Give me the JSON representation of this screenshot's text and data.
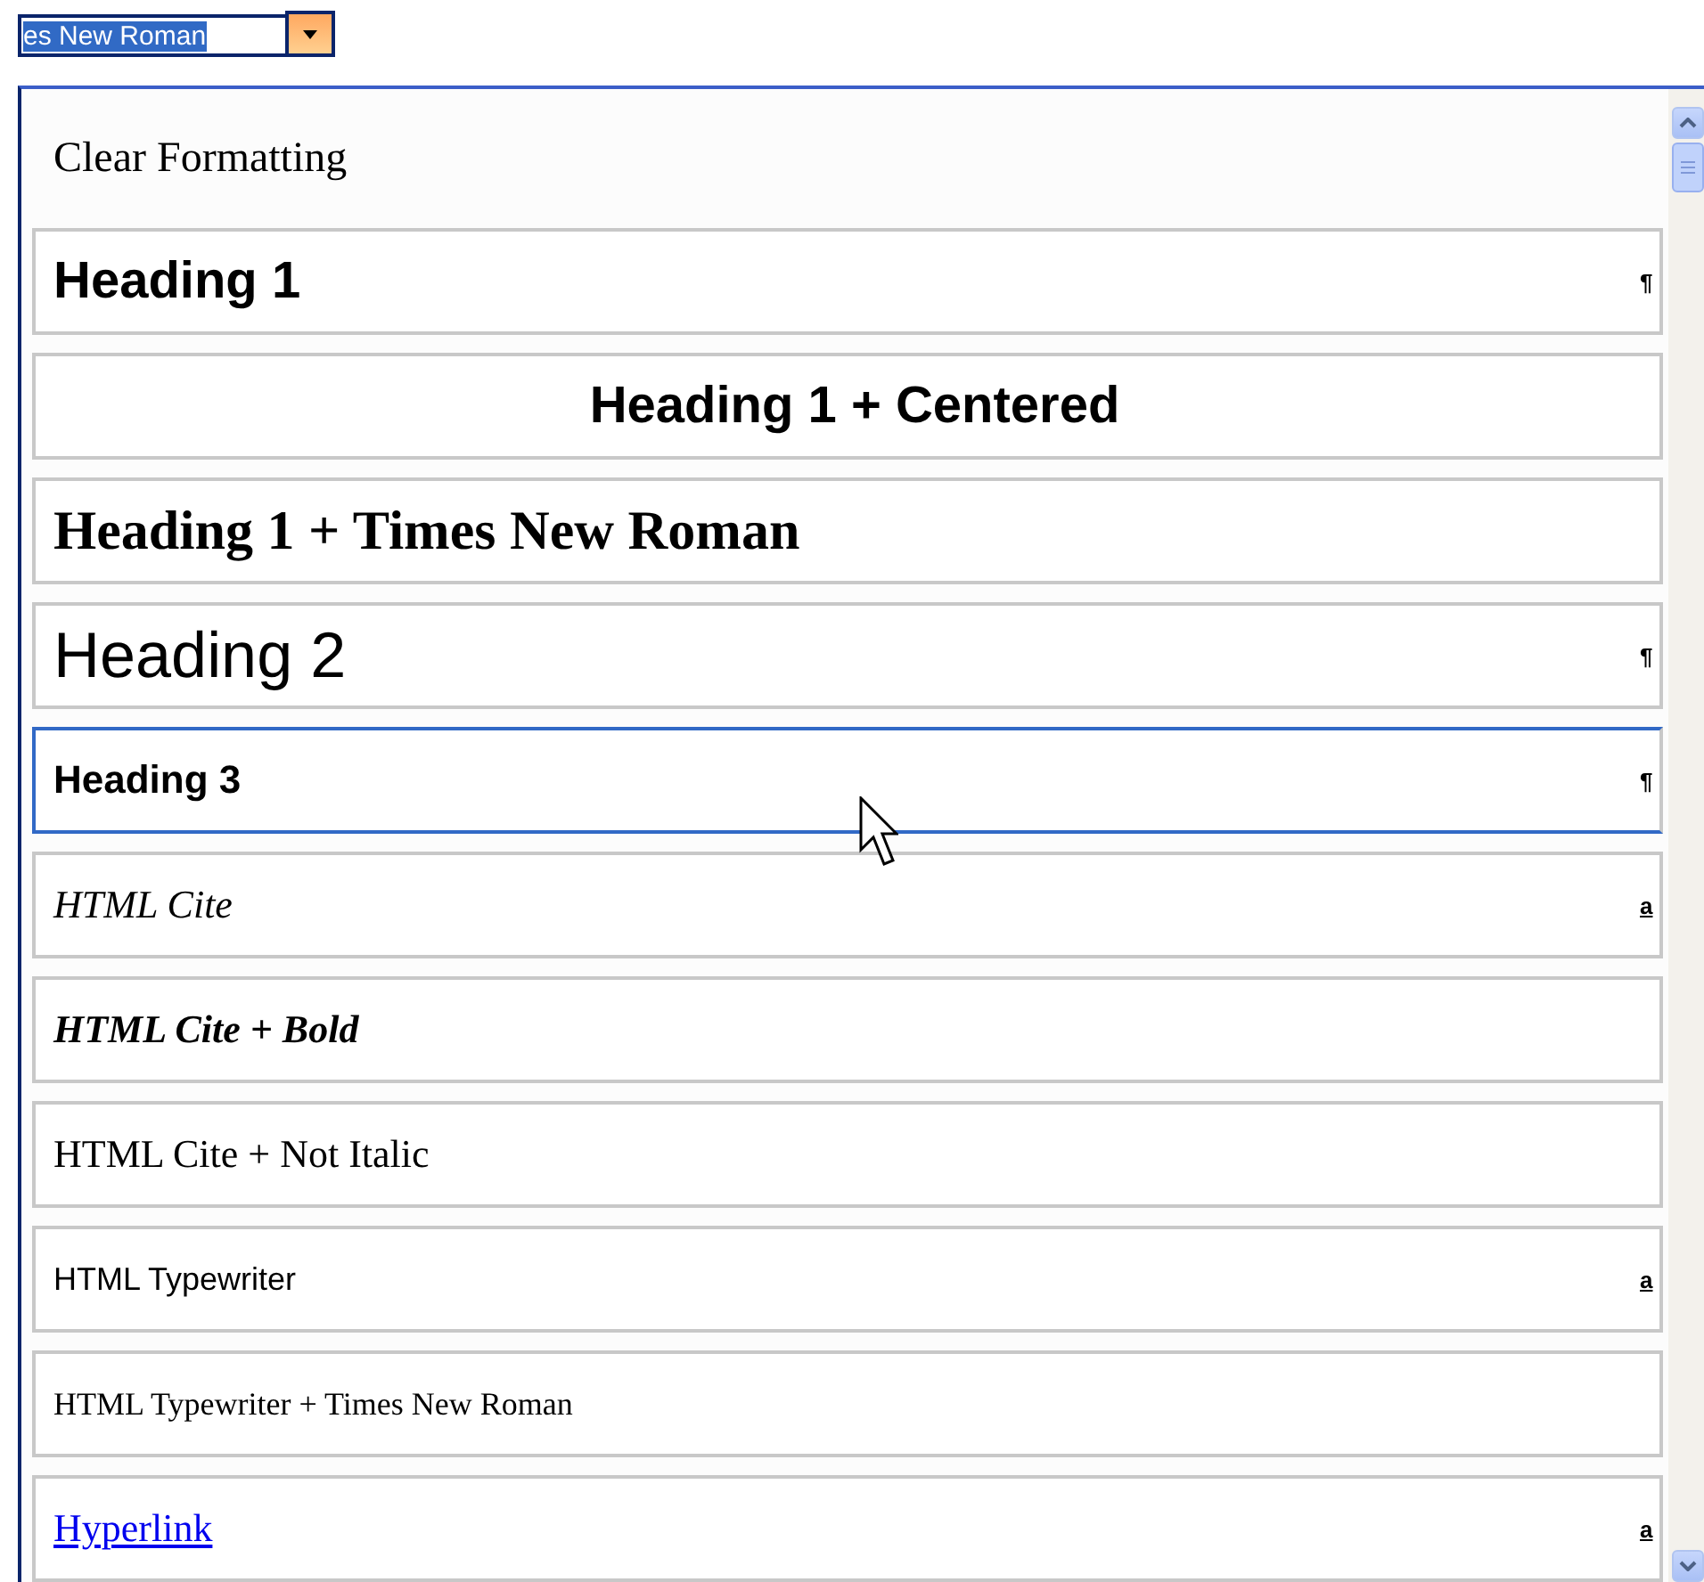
{
  "font_box": {
    "value": "es New Roman",
    "selected": true
  },
  "styles": [
    {
      "label": "Clear Formatting",
      "kind": "clear",
      "selected": false
    },
    {
      "label": "Heading 1",
      "kind": "h1",
      "mark": "¶",
      "selected": false
    },
    {
      "label": "Heading 1 + Centered",
      "kind": "h1c",
      "selected": false
    },
    {
      "label": "Heading 1 + Times New Roman",
      "kind": "h1t",
      "selected": false
    },
    {
      "label": "Heading 2",
      "kind": "h2",
      "mark": "¶",
      "selected": false
    },
    {
      "label": "Heading 3",
      "kind": "h3",
      "mark": "¶",
      "selected": true
    },
    {
      "label": "HTML Cite",
      "kind": "cite",
      "mark": "a",
      "selected": false
    },
    {
      "label": "HTML Cite + Bold",
      "kind": "citebold",
      "selected": false
    },
    {
      "label": "HTML Cite + Not Italic",
      "kind": "citeplain",
      "selected": false
    },
    {
      "label": "HTML Typewriter",
      "kind": "tt",
      "mark": "a",
      "selected": false
    },
    {
      "label": "HTML Typewriter + Times New Roman",
      "kind": "tttimes",
      "selected": false
    },
    {
      "label": "Hyperlink",
      "kind": "link",
      "mark": "a",
      "selected": false
    }
  ]
}
